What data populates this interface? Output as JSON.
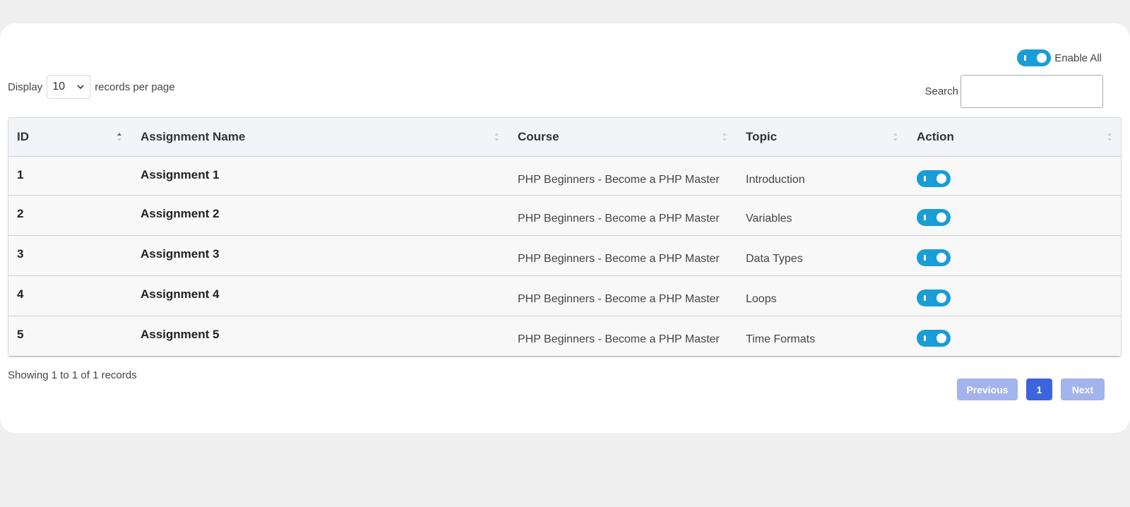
{
  "header": {
    "enable_all_label": "Enable All",
    "enable_all_on": true
  },
  "length_menu": {
    "prefix": "Display",
    "selected": "10",
    "suffix": "records per page"
  },
  "search": {
    "label": "Search",
    "value": ""
  },
  "table": {
    "columns": [
      "ID",
      "Assignment Name",
      "Course",
      "Topic",
      "Action"
    ],
    "rows": [
      {
        "id": "1",
        "name": "Assignment 1",
        "course": "PHP Beginners - Become a PHP Master",
        "topic": "Introduction",
        "enabled": true
      },
      {
        "id": "2",
        "name": "Assignment 2",
        "course": "PHP Beginners - Become a PHP Master",
        "topic": "Variables",
        "enabled": true
      },
      {
        "id": "3",
        "name": "Assignment 3",
        "course": "PHP Beginners - Become a PHP Master",
        "topic": "Data Types",
        "enabled": true
      },
      {
        "id": "4",
        "name": "Assignment 4",
        "course": "PHP Beginners - Become a PHP Master",
        "topic": "Loops",
        "enabled": true
      },
      {
        "id": "5",
        "name": "Assignment 5",
        "course": "PHP Beginners - Become a PHP Master",
        "topic": "Time Formats",
        "enabled": true
      }
    ]
  },
  "footer": {
    "info": "Showing 1 to 1 of 1 records",
    "pagination": {
      "previous": "Previous",
      "current": "1",
      "next": "Next"
    }
  },
  "colors": {
    "toggle_on": "#1a9dd6",
    "page_active": "#3c64dc",
    "page_disabled": "#a3b3ec"
  }
}
